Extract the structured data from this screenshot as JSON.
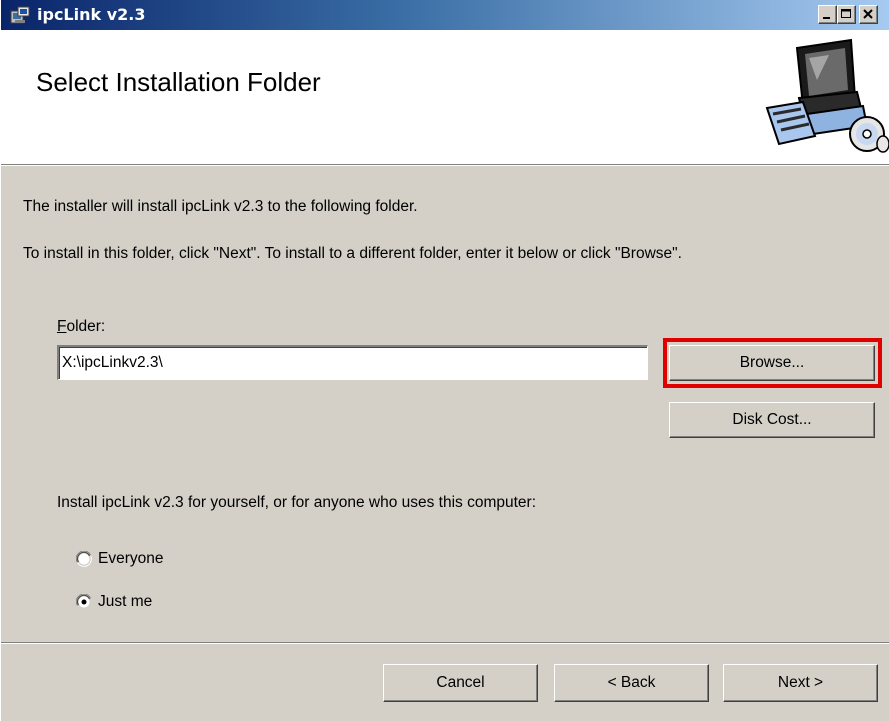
{
  "window": {
    "title": "ipcLink v2.3",
    "title_bar_colors": {
      "start": "#0a246a",
      "end": "#a6caf0"
    }
  },
  "titlebar_buttons": {
    "minimize_icon": "minimize-icon",
    "maximize_icon": "maximize-icon",
    "close_icon": "close-icon"
  },
  "banner": {
    "title": "Select Installation Folder",
    "image_icon": "computer-setup-icon"
  },
  "body": {
    "install_text": "The installer will install ipcLink v2.3 to the following folder.",
    "instruction_text": "To install in this folder, click \"Next\". To install to a different folder, enter it below or click \"Browse\".",
    "folder": {
      "label_prefix": "",
      "label_accel": "F",
      "label_rest": "older:",
      "value": "X:\\ipcLinkv2.3\\"
    },
    "browse_label": "Browse...",
    "disk_cost_label": "Disk Cost...",
    "for_whom_text": "Install ipcLink v2.3 for yourself, or for anyone who uses this computer:",
    "options": [
      {
        "label": "Everyone",
        "selected": false
      },
      {
        "label": "Just me",
        "selected": true
      }
    ],
    "highlight_color": "#e00000"
  },
  "footer": {
    "cancel_label": "Cancel",
    "back_label": "< Back",
    "next_label": "Next >"
  }
}
